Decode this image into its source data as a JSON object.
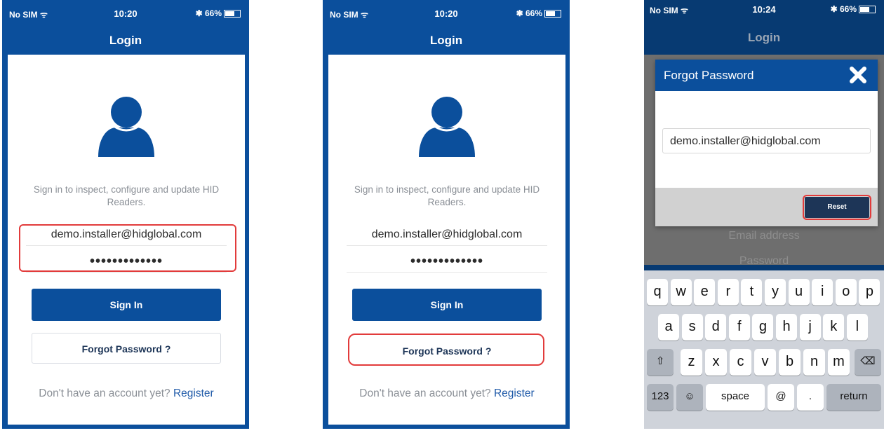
{
  "status": {
    "carrier": "No SIM",
    "battery": "66%",
    "bluetooth": "✱"
  },
  "screens": [
    {
      "time": "10:20",
      "title": "Login",
      "description": "Sign in to inspect, configure and update HID Readers.",
      "email": "demo.installer@hidglobal.com",
      "password": "•••••••••••••",
      "sign_in": "Sign In",
      "forgot": "Forgot Password ?",
      "register_prompt": "Don't have an account yet?",
      "register_link": "Register"
    },
    {
      "time": "10:20",
      "title": "Login",
      "description": "Sign in to inspect, configure and update HID Readers.",
      "email": "demo.installer@hidglobal.com",
      "password": "•••••••••••••",
      "sign_in": "Sign In",
      "forgot": "Forgot Password ?",
      "register_prompt": "Don't have an account yet?",
      "register_link": "Register"
    },
    {
      "time": "10:24",
      "title": "Login",
      "modal_title": "Forgot Password",
      "modal_email": "demo.installer@hidglobal.com",
      "reset": "Reset",
      "email_placeholder": "Email address",
      "password_placeholder": "Password",
      "keyboard": {
        "row1": [
          "q",
          "w",
          "e",
          "r",
          "t",
          "y",
          "u",
          "i",
          "o",
          "p"
        ],
        "row2": [
          "a",
          "s",
          "d",
          "f",
          "g",
          "h",
          "j",
          "k",
          "l"
        ],
        "row3": [
          "z",
          "x",
          "c",
          "v",
          "b",
          "n",
          "m"
        ],
        "numbers": "123",
        "emoji": "☺",
        "space": "space",
        "at": "@",
        "dot": ".",
        "return": "return"
      }
    }
  ],
  "colors": {
    "brand": "#0b4f9c",
    "highlight": "#e23b3b"
  }
}
